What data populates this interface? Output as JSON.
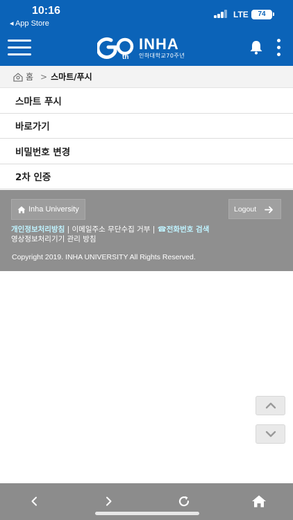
{
  "status_bar": {
    "time": "10:16",
    "back_app": "◂ App Store",
    "network": "LTE",
    "battery": "74"
  },
  "header": {
    "logo_text": "INHA",
    "logo_subtitle": "인하대학교70주년",
    "logo_mark": "G70th",
    "bg_color": "#0b63b8"
  },
  "breadcrumb": {
    "home": "홈",
    "separator": ">",
    "current": "스마트/푸시"
  },
  "menu_items": [
    {
      "label": "스마트 푸시"
    },
    {
      "label": "바로가기"
    },
    {
      "label": "비밀번호 변경"
    },
    {
      "label": "2차 인증"
    }
  ],
  "footer": {
    "university_button": "Inha University",
    "logout_button": "Logout",
    "privacy_policy": "개인정보처리방침",
    "email_refusal": "이메일주소 무단수집 거부",
    "phone_search": "☎전화번호 검색",
    "divider": "|",
    "video_policy": "영상정보처리기기 관리 방침",
    "copyright": "Copyright 2019. INHA UNIVERSITY All Rights Reserved.",
    "bg_color": "#8f8f8f",
    "highlight_color": "#bff3ff"
  },
  "scroll": {
    "up_icon": "chevron-up-icon",
    "down_icon": "chevron-down-icon"
  },
  "toolbar": {
    "back_icon": "chevron-left-icon",
    "forward_icon": "chevron-right-icon",
    "reload_icon": "reload-icon",
    "home_icon": "home-icon"
  }
}
